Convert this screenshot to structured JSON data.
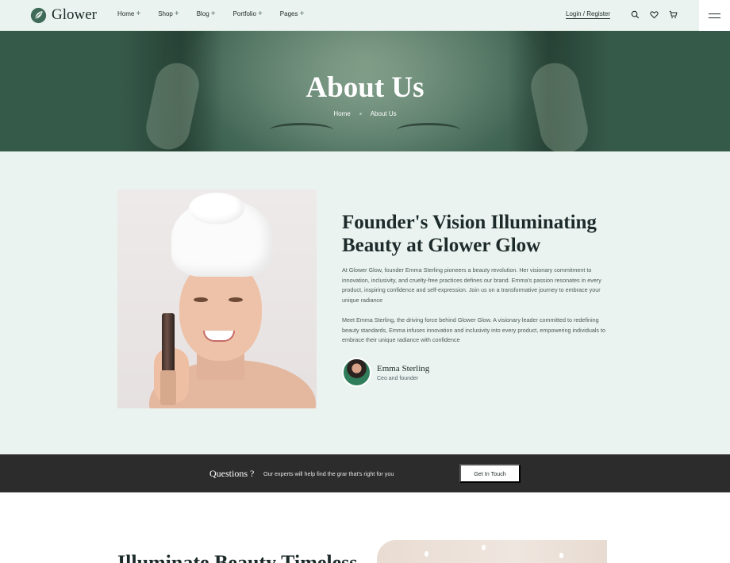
{
  "header": {
    "logo_text": "Glower",
    "nav": [
      {
        "label": "Home",
        "expand": "+"
      },
      {
        "label": "Shop",
        "expand": "+"
      },
      {
        "label": "Blog",
        "expand": "+"
      },
      {
        "label": "Portfolio",
        "expand": "+"
      },
      {
        "label": "Pages",
        "expand": "+"
      }
    ],
    "auth_label": "Login / Register",
    "icons": [
      "search-icon",
      "heart-icon",
      "cart-icon",
      "menu-icon"
    ]
  },
  "hero": {
    "title": "About Us",
    "breadcrumb": [
      "Home",
      "About Us"
    ]
  },
  "about": {
    "title": "Founder's Vision Illuminating Beauty at Glower Glow",
    "paragraph_1": "At Glower Glow, founder Emma Sterling pioneers a beauty revolution. Her visionary commitment to innovation, inclusivity, and cruelty-free practices defines our brand. Emma's passion resonates in every product, inspiring confidence and self-expression. Join us on a transformative journey to embrace your unique radiance",
    "paragraph_2": "Meet Emma Sterling, the driving force behind Glower Glow. A visionary leader committed to redefining beauty standards, Emma infuses innovation and inclusivity into every product, empowering individuals to embrace their unique radiance with confidence",
    "author_name": "Emma Sterling",
    "author_role": "Ceo and founder"
  },
  "band": {
    "question": "Questions ?",
    "text": "Our experts will help find the grar that's right for you",
    "button": "Get In Touch"
  },
  "next_section": {
    "title": "Illuminate Beauty Timeless"
  },
  "colors": {
    "header_bg": "#eaf3ef",
    "hero_bg": "#4c705f",
    "band_bg": "#2c2c2c",
    "text_dark": "#1c2a2a"
  }
}
